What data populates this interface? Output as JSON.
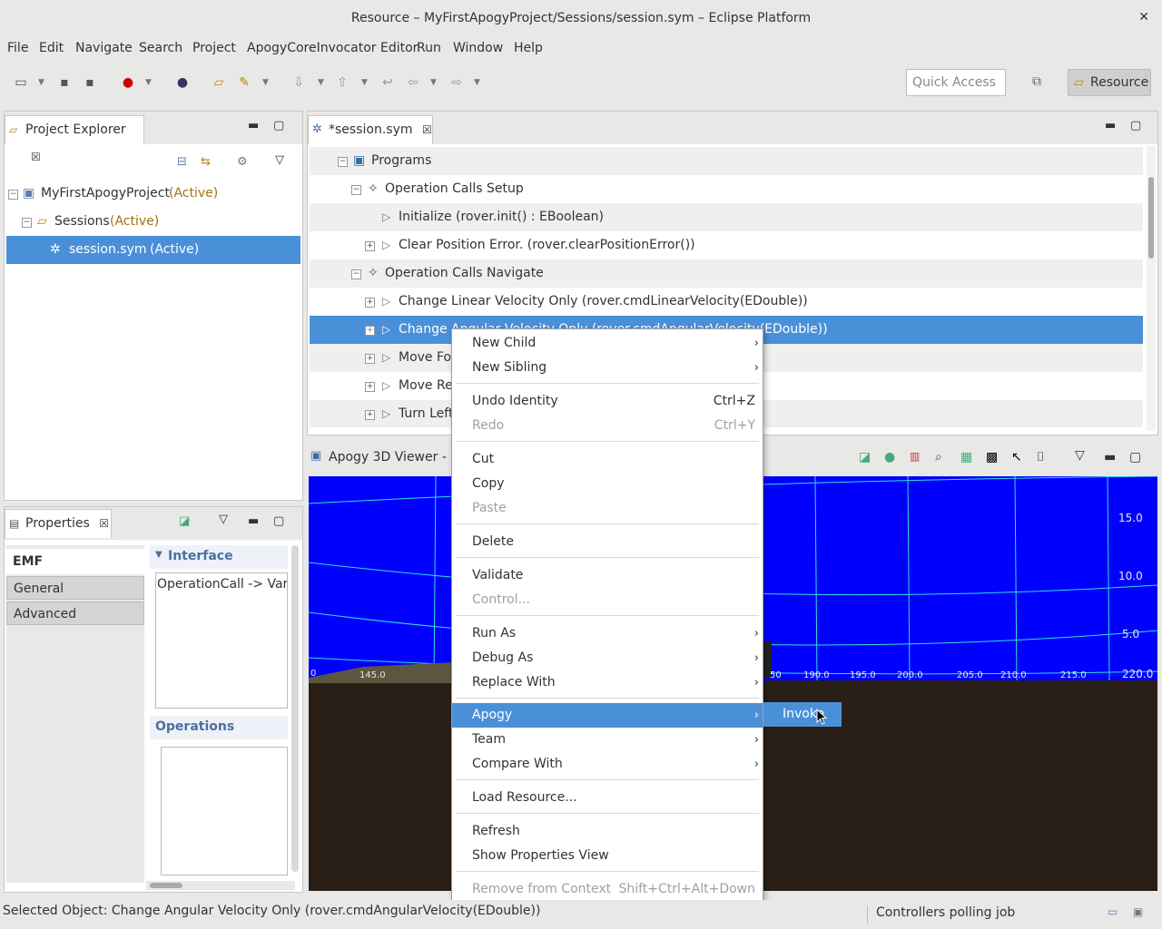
{
  "window": {
    "title": "Resource – MyFirstApogyProject/Sessions/session.sym – Eclipse Platform",
    "close": "✕"
  },
  "menubar": [
    "File",
    "Edit",
    "Navigate",
    "Search",
    "Project",
    "ApogyCoreInvocator Editor",
    "Run",
    "Window",
    "Help"
  ],
  "toolbar": {
    "quick_access_placeholder": "Quick Access",
    "perspective": "Resource"
  },
  "project_explorer": {
    "title": "Project Explorer",
    "items": [
      {
        "name": "MyFirstApogyProject",
        "state": "(Active)"
      },
      {
        "name": "Sessions",
        "state": "(Active)"
      },
      {
        "name": "session.sym",
        "state": "(Active)"
      }
    ]
  },
  "properties": {
    "title": "Properties",
    "tabs": [
      "EMF Documentation",
      "General",
      "Advanced"
    ],
    "interface_heading": "Interface",
    "interface_text": "OperationCall -> Variab",
    "operations_heading": "Operations"
  },
  "editor": {
    "tab": "*session.sym",
    "rows": [
      "Programs",
      "Operation Calls Setup",
      "Initialize (rover.init() : EBoolean)",
      "Clear Position Error. (rover.clearPositionError())",
      "Operation Calls Navigate",
      "Change Linear Velocity Only (rover.cmdLinearVelocity(EDouble))",
      "Change Angular Velocity Only (rover.cmdAngularVelocity(EDouble))",
      "Move For",
      "Move Rev",
      "Turn Left"
    ]
  },
  "viewer": {
    "title": "Apogy 3D Viewer - ?",
    "x_labels": [
      "0",
      "145.0",
      "50",
      "190.0",
      "195.0",
      "200.0",
      "205.0",
      "210.0",
      "215.0",
      "220.0"
    ],
    "y_labels": [
      "15.0",
      "10.0",
      "5.0"
    ]
  },
  "context_menu": {
    "items": [
      {
        "label": "New Child",
        "sub": "›"
      },
      {
        "label": "New Sibling",
        "sub": "›"
      },
      {
        "label": "Undo Identity",
        "acc": "Ctrl+Z"
      },
      {
        "label": "Redo",
        "acc": "Ctrl+Y"
      },
      {
        "label": "Cut"
      },
      {
        "label": "Copy"
      },
      {
        "label": "Paste"
      },
      {
        "label": "Delete"
      },
      {
        "label": "Validate"
      },
      {
        "label": "Control..."
      },
      {
        "label": "Run As",
        "sub": "›"
      },
      {
        "label": "Debug As",
        "sub": "›"
      },
      {
        "label": "Replace With",
        "sub": "›"
      },
      {
        "label": "Apogy",
        "sub": "›"
      },
      {
        "label": "Team",
        "sub": "›"
      },
      {
        "label": "Compare With",
        "sub": "›"
      },
      {
        "label": "Load Resource..."
      },
      {
        "label": "Refresh"
      },
      {
        "label": "Show Properties View"
      },
      {
        "label": "Remove from Context",
        "acc": "Shift+Ctrl+Alt+Down"
      }
    ],
    "submenu_item": "Invoke"
  },
  "status": {
    "selected": "Selected Object: Change Angular Velocity Only (rover.cmdAngularVelocity(EDouble))",
    "job": "Controllers polling job"
  }
}
